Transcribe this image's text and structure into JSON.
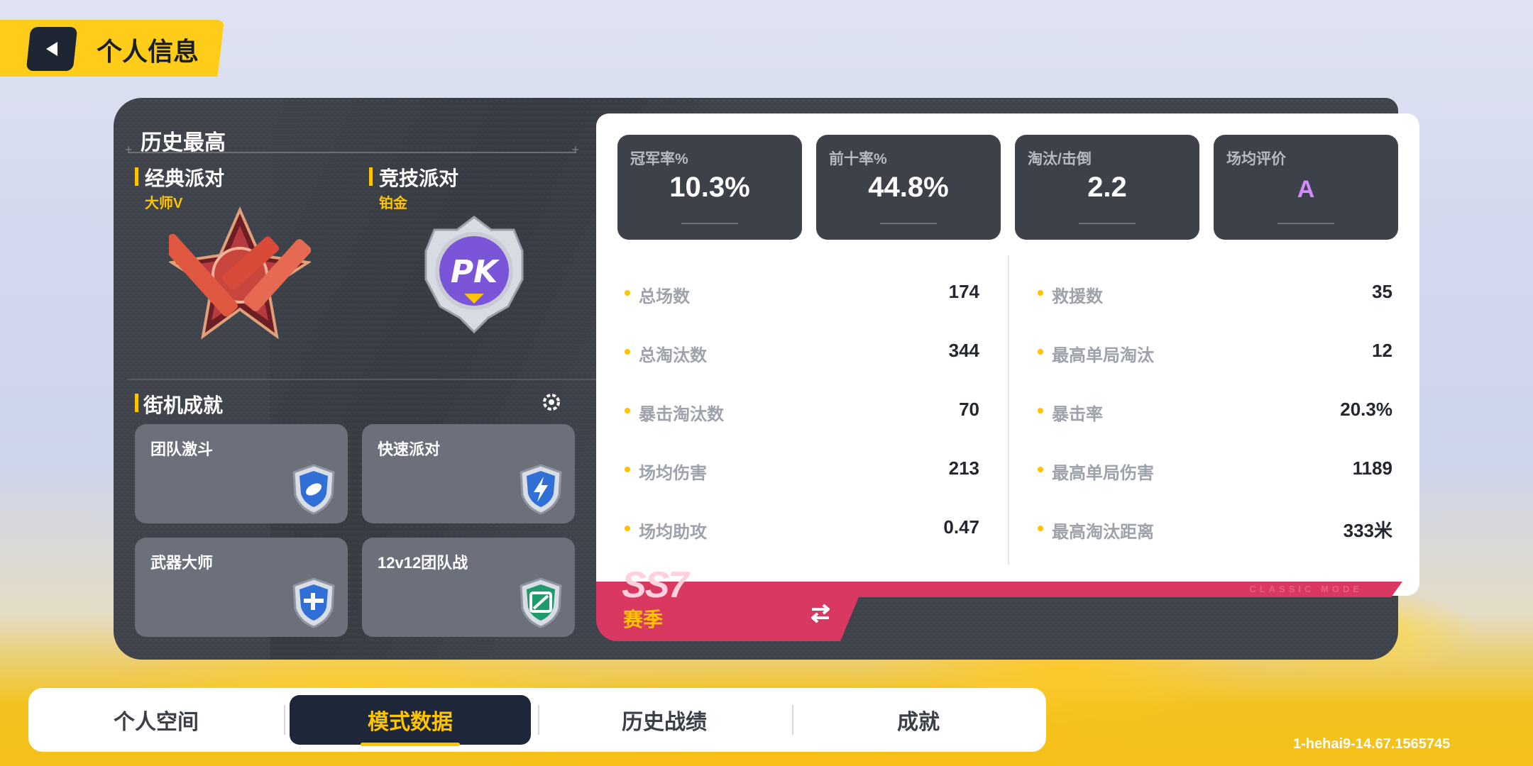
{
  "header": {
    "title": "个人信息"
  },
  "history": {
    "title": "历史最高",
    "ranks": [
      {
        "mode": "经典派对",
        "tier": "大师V"
      },
      {
        "mode": "竞技派对",
        "tier": "铂金"
      }
    ]
  },
  "arcade": {
    "title": "街机成就",
    "modes": [
      {
        "name": "团队激斗"
      },
      {
        "name": "快速派对"
      },
      {
        "name": "武器大师"
      },
      {
        "name": "12v12团队战"
      }
    ]
  },
  "kpis": [
    {
      "label": "冠军率%",
      "value": "10.3%"
    },
    {
      "label": "前十率%",
      "value": "44.8%"
    },
    {
      "label": "淘汰/击倒",
      "value": "2.2"
    },
    {
      "label": "场均评价",
      "value": "A"
    }
  ],
  "stats_left": [
    {
      "label": "总场数",
      "value": "174"
    },
    {
      "label": "总淘汰数",
      "value": "344"
    },
    {
      "label": "暴击淘汰数",
      "value": "70"
    },
    {
      "label": "场均伤害",
      "value": "213"
    },
    {
      "label": "场均助攻",
      "value": "0.47"
    }
  ],
  "stats_right": [
    {
      "label": "救援数",
      "value": "35"
    },
    {
      "label": "最高单局淘汰",
      "value": "12"
    },
    {
      "label": "暴击率",
      "value": "20.3%"
    },
    {
      "label": "最高单局伤害",
      "value": "1189"
    },
    {
      "label": "最高淘汰距离",
      "value": "333米"
    }
  ],
  "season": {
    "code": "SS7",
    "label": "赛季",
    "ribbon_text": "CLASSIC MODE"
  },
  "tabs": [
    {
      "label": "个人空间",
      "active": false
    },
    {
      "label": "模式数据",
      "active": true
    },
    {
      "label": "历史战绩",
      "active": false
    },
    {
      "label": "成就",
      "active": false
    }
  ],
  "version": "1-hehai9-14.67.1565745",
  "colors": {
    "accent": "#ffc400",
    "panel": "#3f434b",
    "season": "#d93860",
    "tab_active": "#1e2739"
  }
}
